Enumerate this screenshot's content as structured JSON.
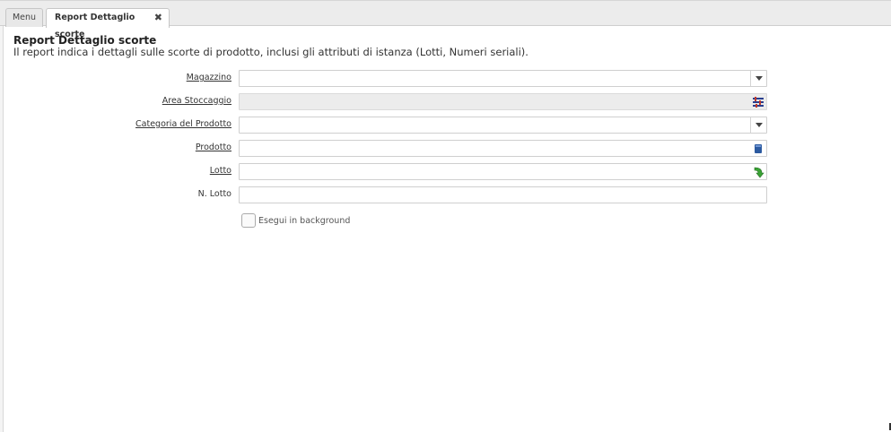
{
  "tabs": [
    {
      "label": "Menu"
    },
    {
      "label": "Report Dettaglio scorte",
      "close": "✖"
    }
  ],
  "header": {
    "title": "Report Dettaglio scorte",
    "description": "Il report indica i dettagli sulle scorte di prodotto, inclusi gli attributi di istanza (Lotti, Numeri seriali)."
  },
  "form": {
    "fields": [
      {
        "label": "Magazzino",
        "value": "",
        "control": "dropdown"
      },
      {
        "label": "Area Stoccaggio",
        "value": "",
        "control": "locator",
        "disabled": true
      },
      {
        "label": "Categoria del Prodotto",
        "value": "",
        "control": "dropdown"
      },
      {
        "label": "Prodotto",
        "value": "",
        "control": "search"
      },
      {
        "label": "Lotto",
        "value": "",
        "control": "lot"
      },
      {
        "label": "N. Lotto",
        "value": "",
        "control": "text"
      }
    ],
    "run_in_background": {
      "label": "Esegui in background",
      "checked": false
    }
  },
  "colors": {
    "tabbar_bg": "#ececec",
    "field_border": "#cfcfcf",
    "disabled_bg": "#ececec"
  },
  "icons": [
    "close-icon",
    "dropdown-arrow-icon",
    "locator-icon",
    "product-search-icon",
    "lot-arrow-icon",
    "checkbox"
  ]
}
